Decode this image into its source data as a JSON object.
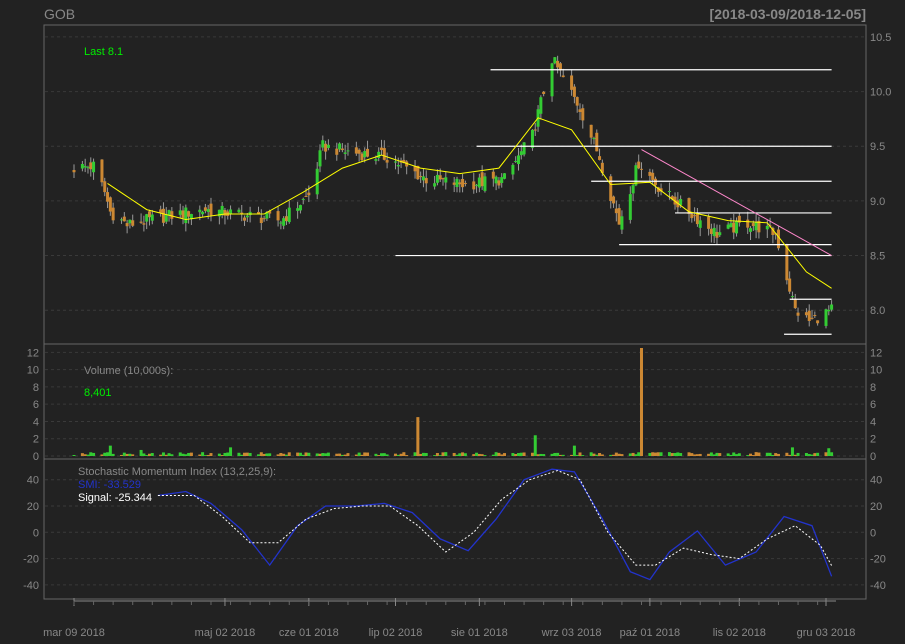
{
  "header": {
    "title": "GOB",
    "date_range": "[2018-03-09/2018-12-05]"
  },
  "colors": {
    "up": "#33cc33",
    "down": "#cc8833",
    "ma": "#ffff00",
    "trend": "#ff88cc",
    "smi": "#2233cc",
    "signal": "#ffffff",
    "label": "#888888",
    "last": "#00ee00",
    "bg": "#222222"
  },
  "chart_data": [
    {
      "type": "candlestick",
      "panel": "price",
      "annotation": "Last 8.1",
      "ylim": [
        7.7,
        10.6
      ],
      "yticks": [
        8.0,
        8.5,
        9.0,
        9.5,
        10.0,
        10.5
      ],
      "ytick_labels": [
        "8.0",
        "8.5",
        "9.0",
        "9.5",
        "10.0",
        "10.5"
      ],
      "moving_average": [
        [
          "2018-03-21",
          9.16
        ],
        [
          "2018-04-04",
          8.92
        ],
        [
          "2018-04-18",
          8.83
        ],
        [
          "2018-05-02",
          8.88
        ],
        [
          "2018-05-16",
          8.88
        ],
        [
          "2018-05-30",
          9.08
        ],
        [
          "2018-06-13",
          9.3
        ],
        [
          "2018-06-27",
          9.42
        ],
        [
          "2018-07-11",
          9.3
        ],
        [
          "2018-07-25",
          9.25
        ],
        [
          "2018-08-08",
          9.3
        ],
        [
          "2018-08-22",
          9.76
        ],
        [
          "2018-09-03",
          9.65
        ],
        [
          "2018-09-17",
          9.15
        ],
        [
          "2018-10-01",
          9.17
        ],
        [
          "2018-10-15",
          8.9
        ],
        [
          "2018-10-29",
          8.82
        ],
        [
          "2018-11-12",
          8.8
        ],
        [
          "2018-11-26",
          8.35
        ],
        [
          "2018-12-05",
          8.2
        ]
      ],
      "trend_line": [
        [
          "2018-09-28",
          9.47
        ],
        [
          "2018-12-05",
          8.5
        ]
      ],
      "support_resistance": [
        {
          "start": "2018-08-05",
          "end": "2018-12-05",
          "value": 10.2
        },
        {
          "start": "2018-07-31",
          "end": "2018-12-05",
          "value": 9.5
        },
        {
          "start": "2018-09-10",
          "end": "2018-12-05",
          "value": 9.18
        },
        {
          "start": "2018-10-10",
          "end": "2018-12-05",
          "value": 8.89
        },
        {
          "start": "2018-09-20",
          "end": "2018-12-05",
          "value": 8.6
        },
        {
          "start": "2018-07-02",
          "end": "2018-12-05",
          "value": 8.5
        },
        {
          "start": "2018-11-20",
          "end": "2018-12-05",
          "value": 8.1
        },
        {
          "start": "2018-11-18",
          "end": "2018-12-05",
          "value": 7.78
        }
      ],
      "close_anchors": [
        [
          "2018-03-09",
          9.3
        ],
        [
          "2018-03-16",
          9.32
        ],
        [
          "2018-03-20",
          9.08
        ],
        [
          "2018-03-22",
          8.9
        ],
        [
          "2018-03-28",
          8.78
        ],
        [
          "2018-04-11",
          8.86
        ],
        [
          "2018-04-25",
          8.92
        ],
        [
          "2018-05-09",
          8.87
        ],
        [
          "2018-05-22",
          8.82
        ],
        [
          "2018-06-01",
          9.05
        ],
        [
          "2018-06-06",
          9.5
        ],
        [
          "2018-06-15",
          9.45
        ],
        [
          "2018-06-29",
          9.4
        ],
        [
          "2018-07-13",
          9.2
        ],
        [
          "2018-07-27",
          9.15
        ],
        [
          "2018-08-10",
          9.2
        ],
        [
          "2018-08-20",
          9.6
        ],
        [
          "2018-08-27",
          10.3
        ],
        [
          "2018-09-06",
          9.85
        ],
        [
          "2018-09-13",
          9.4
        ],
        [
          "2018-09-20",
          8.8
        ],
        [
          "2018-09-27",
          9.35
        ],
        [
          "2018-10-05",
          9.1
        ],
        [
          "2018-10-15",
          8.9
        ],
        [
          "2018-10-25",
          8.7
        ],
        [
          "2018-11-05",
          8.8
        ],
        [
          "2018-11-15",
          8.7
        ],
        [
          "2018-11-22",
          8.0
        ],
        [
          "2018-11-27",
          7.9
        ],
        [
          "2018-12-05",
          8.0
        ]
      ]
    },
    {
      "type": "bar",
      "panel": "volume",
      "label": "Volume (10,000s):",
      "last_value": "8,401",
      "ylim": [
        0,
        12.5
      ],
      "yticks": [
        0,
        2,
        4,
        6,
        8,
        10,
        12
      ],
      "ytick_labels": [
        "0",
        "2",
        "4",
        "6",
        "8",
        "10",
        "12"
      ],
      "spikes": [
        [
          "2018-03-22",
          1.2
        ],
        [
          "2018-04-02",
          0.7
        ],
        [
          "2018-05-04",
          1.0
        ],
        [
          "2018-07-10",
          4.5
        ],
        [
          "2018-08-21",
          2.4
        ],
        [
          "2018-09-04",
          1.2
        ],
        [
          "2018-09-28",
          12.5
        ],
        [
          "2018-11-21",
          1.0
        ],
        [
          "2018-12-04",
          0.9
        ]
      ]
    },
    {
      "type": "line",
      "panel": "smi",
      "label": "Stochastic Momentum Index (13,2,25,9):",
      "series_labels": [
        "SMI: -33.529",
        "Signal: -25.344"
      ],
      "ylim": [
        -50,
        55
      ],
      "yticks": [
        -40,
        -20,
        0,
        20,
        40
      ],
      "ytick_labels": [
        "-40",
        "-20",
        "0",
        "20",
        "40"
      ],
      "series": [
        {
          "name": "SMI",
          "values": [
            [
              "2018-04-08",
              28
            ],
            [
              "2018-04-18",
              31
            ],
            [
              "2018-04-27",
              22
            ],
            [
              "2018-05-08",
              2
            ],
            [
              "2018-05-18",
              -25
            ],
            [
              "2018-05-28",
              5
            ],
            [
              "2018-06-07",
              20
            ],
            [
              "2018-06-18",
              20
            ],
            [
              "2018-06-28",
              22
            ],
            [
              "2018-07-08",
              15
            ],
            [
              "2018-07-18",
              -5
            ],
            [
              "2018-07-28",
              -14
            ],
            [
              "2018-08-07",
              10
            ],
            [
              "2018-08-17",
              40
            ],
            [
              "2018-08-27",
              48
            ],
            [
              "2018-09-04",
              46
            ],
            [
              "2018-09-14",
              10
            ],
            [
              "2018-09-24",
              -30
            ],
            [
              "2018-10-01",
              -36
            ],
            [
              "2018-10-08",
              -15
            ],
            [
              "2018-10-18",
              1
            ],
            [
              "2018-10-28",
              -25
            ],
            [
              "2018-11-08",
              -15
            ],
            [
              "2018-11-18",
              12
            ],
            [
              "2018-11-28",
              5
            ],
            [
              "2018-12-05",
              -33.5
            ]
          ]
        },
        {
          "name": "Signal",
          "values": [
            [
              "2018-04-08",
              28
            ],
            [
              "2018-04-21",
              28
            ],
            [
              "2018-05-01",
              12
            ],
            [
              "2018-05-11",
              -8
            ],
            [
              "2018-05-21",
              -8
            ],
            [
              "2018-05-31",
              10
            ],
            [
              "2018-06-10",
              18
            ],
            [
              "2018-06-20",
              20
            ],
            [
              "2018-06-30",
              20
            ],
            [
              "2018-07-10",
              5
            ],
            [
              "2018-07-20",
              -15
            ],
            [
              "2018-07-30",
              0
            ],
            [
              "2018-08-09",
              25
            ],
            [
              "2018-08-19",
              40
            ],
            [
              "2018-08-29",
              47
            ],
            [
              "2018-09-06",
              40
            ],
            [
              "2018-09-16",
              0
            ],
            [
              "2018-09-26",
              -25
            ],
            [
              "2018-10-03",
              -25
            ],
            [
              "2018-10-13",
              -12
            ],
            [
              "2018-10-23",
              -17
            ],
            [
              "2018-11-02",
              -20
            ],
            [
              "2018-11-12",
              -5
            ],
            [
              "2018-11-22",
              5
            ],
            [
              "2018-12-01",
              -10
            ],
            [
              "2018-12-05",
              -25.3
            ]
          ]
        }
      ]
    }
  ],
  "x_axis": {
    "ticks": [
      {
        "date": "2018-03-09",
        "label": "mar 09 2018"
      },
      {
        "date": "2018-05-02",
        "label": "maj 02 2018"
      },
      {
        "date": "2018-06-01",
        "label": "cze 01 2018"
      },
      {
        "date": "2018-07-02",
        "label": "lip 02 2018"
      },
      {
        "date": "2018-08-01",
        "label": "sie 01 2018"
      },
      {
        "date": "2018-09-03",
        "label": "wrz 03 2018"
      },
      {
        "date": "2018-10-01",
        "label": "paź 01 2018"
      },
      {
        "date": "2018-11-02",
        "label": "lis 02 2018"
      },
      {
        "date": "2018-12-03",
        "label": "gru 03 2018"
      }
    ]
  }
}
